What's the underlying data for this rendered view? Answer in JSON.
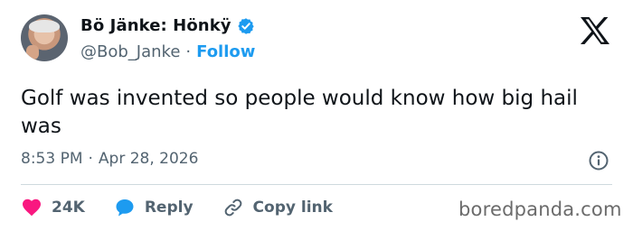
{
  "author": {
    "display_name": "Bö Jänke: Hönkÿ",
    "handle": "@Bob_Janke",
    "separator": "·",
    "follow_label": "Follow",
    "verified_color": "#1d9bf0"
  },
  "tweet": {
    "text": "Golf was invented so people would know how big hail was",
    "time": "8:53 PM",
    "date_separator": "·",
    "date": "Apr 28, 2026"
  },
  "actions": {
    "likes": "24K",
    "reply_label": "Reply",
    "copy_label": "Copy link"
  },
  "icons": [
    "x-logo-icon",
    "verified-badge-icon",
    "info-icon",
    "heart-icon",
    "reply-bubble-icon",
    "link-icon"
  ],
  "watermark": "boredpanda.com",
  "colors": {
    "like": "#f91880",
    "reply": "#1d9bf0",
    "accent": "#1d9bf0",
    "muted_text": "#536471"
  }
}
